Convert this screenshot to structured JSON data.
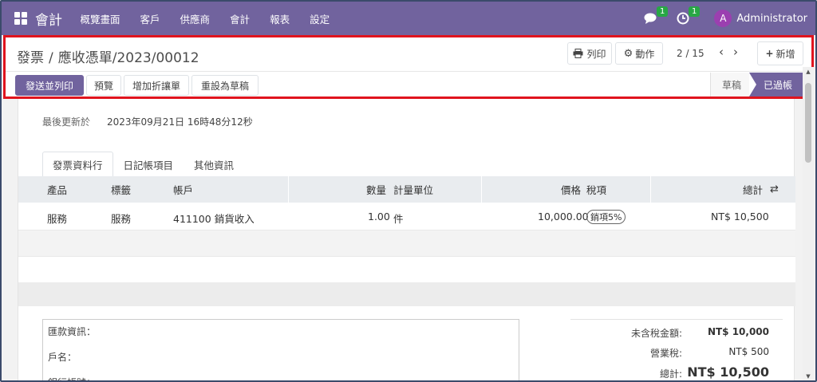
{
  "nav": {
    "brand": "會計",
    "menu": [
      "概覽畫面",
      "客戶",
      "供應商",
      "會計",
      "報表",
      "設定"
    ],
    "chat_count": "1",
    "activity_count": "1",
    "avatar_letter": "A",
    "user": "Administrator"
  },
  "control": {
    "breadcrumb_parent": "發票",
    "breadcrumb_current": "應收憑單/2023/00012",
    "print_label": "列印",
    "action_label": "動作",
    "pager": "2 / 15",
    "new_label": "新增",
    "buttons": [
      "發送並列印",
      "預覽",
      "增加折讓單",
      "重設為草稿"
    ],
    "stages": [
      "草稿",
      "已過帳"
    ]
  },
  "sheet": {
    "updated_label": "最後更新於",
    "updated_value": "2023年09月21日 16時48分12秒",
    "tabs": [
      "發票資料行",
      "日記帳項目",
      "其他資訊"
    ],
    "columns": {
      "product": "產品",
      "label": "標籤",
      "account": "帳戶",
      "quantity": "數量",
      "uom": "計量單位",
      "price": "價格",
      "taxes": "稅項",
      "subtotal": "總計"
    },
    "line": {
      "product": "服務",
      "label": "服務",
      "account": "411100 銷貨收入",
      "quantity": "1.00",
      "uom": "件",
      "price": "10,000.00",
      "tax": "銷項5%",
      "subtotal": "NT$ 10,500"
    },
    "bank": [
      "匯款資訊：",
      "戶名：",
      "銀行帳號："
    ],
    "totals": {
      "untaxed_label": "未含稅金額:",
      "untaxed_value": "NT$ 10,000",
      "tax_label": "營業稅:",
      "tax_value": "NT$ 500",
      "total_label": "總計:",
      "total_value": "NT$ 10,500"
    }
  },
  "colors": {
    "brand": "#71639e",
    "highlight_border": "#e0141e",
    "badge": "#28a745",
    "avatar": "#9b3fb0"
  }
}
